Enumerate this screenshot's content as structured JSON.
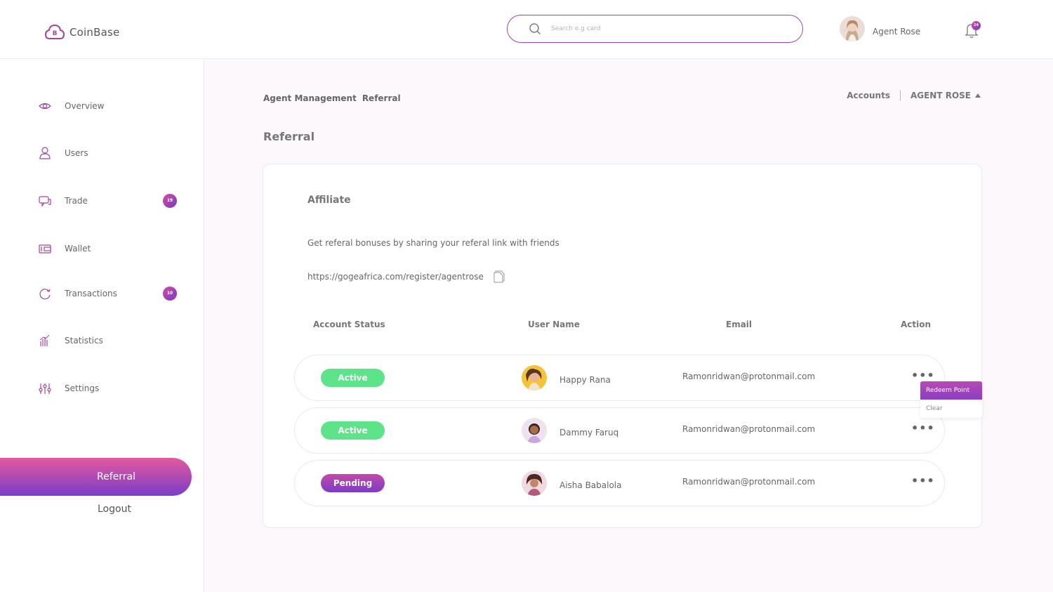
{
  "app": {
    "name": "CoinBase"
  },
  "search": {
    "placeholder": "Search e.g card"
  },
  "profile": {
    "name": "Agent Rose",
    "notification_count": "24"
  },
  "sidebar": {
    "items": [
      {
        "label": "Overview",
        "icon": "eye-icon"
      },
      {
        "label": "Users",
        "icon": "user-icon"
      },
      {
        "label": "Trade",
        "icon": "chat-icon",
        "badge": "19"
      },
      {
        "label": "Wallet",
        "icon": "wallet-icon"
      },
      {
        "label": "Transactions",
        "icon": "refresh-icon",
        "badge": "10"
      },
      {
        "label": "Statistics",
        "icon": "bar-chart-icon"
      },
      {
        "label": "Settings",
        "icon": "sliders-icon"
      }
    ],
    "active": "Referral",
    "logout": "Logout"
  },
  "breadcrumb": {
    "parent": "Agent Management",
    "current": "Referral"
  },
  "topnav": {
    "accounts": "Accounts",
    "agent": "AGENT ROSE"
  },
  "page": {
    "title": "Referral"
  },
  "affiliate": {
    "title": "Affiliate",
    "description": "Get referal bonuses by sharing your referal link with friends",
    "link": "https://gogeafrica.com/register/agentrose"
  },
  "table": {
    "headers": [
      "Account Status",
      "User Name",
      "Email",
      "Action"
    ],
    "rows": [
      {
        "status": "Active",
        "name": "Happy Rana",
        "email": "Ramonridwan@protonmail.com"
      },
      {
        "status": "Active",
        "name": "Dammy Faruq",
        "email": "Ramonridwan@protonmail.com"
      },
      {
        "status": "Pending",
        "name": "Aisha Babalola",
        "email": "Ramonridwan@protonmail.com"
      }
    ],
    "action_symbol": "•••"
  },
  "action_menu": {
    "items": [
      "Redeem Point",
      "Clear"
    ]
  },
  "colors": {
    "accent": "#9b44b8",
    "active": "#5de38a",
    "gradient_start": "#e35a9d",
    "gradient_end": "#7b3cc8"
  }
}
